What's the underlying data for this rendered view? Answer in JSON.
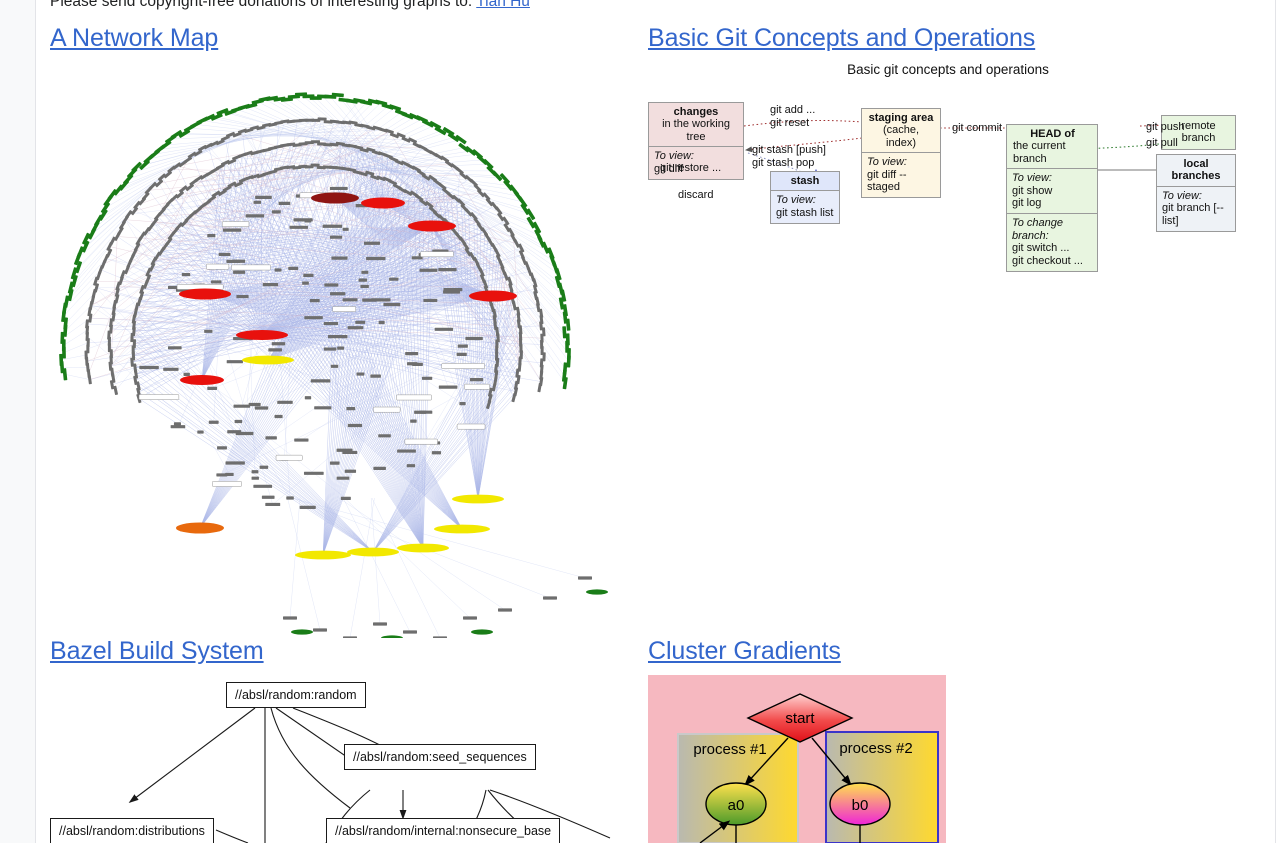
{
  "intro": {
    "text_before": "Please send copyright-free donations of interesting graphs to:",
    "link_label": "Tian Hu"
  },
  "sections": [
    {
      "id": "network-map",
      "title": "A Network Map"
    },
    {
      "id": "basic-git",
      "title": "Basic Git Concepts and Operations"
    },
    {
      "id": "bazel",
      "title": "Bazel Build System"
    },
    {
      "id": "cluster-gradients",
      "title": "Cluster Gradients"
    }
  ],
  "git": {
    "caption": "Basic git concepts and operations",
    "boxes": [
      {
        "key": "changes",
        "head_line1": "changes",
        "head_line2": "in the working tree",
        "body_label": "To view:",
        "body_cmd": "git diff",
        "color": "#f2dede"
      },
      {
        "key": "staging",
        "head_line1": "staging area",
        "head_line2": "(cache, index)",
        "body_label": "To view:",
        "body_cmd": "git diff --staged",
        "color": "#fdf6e3"
      },
      {
        "key": "stash",
        "head_line1": "stash",
        "head_line2": "",
        "body_label": "To view:",
        "body_cmd": "git stash list",
        "color": "#e8edfb"
      },
      {
        "key": "head",
        "head_line1": "HEAD of",
        "head_line2": "the current branch",
        "body_label": "To view:",
        "body_cmd": "git show\ngit log",
        "body2_label": "To change branch:",
        "body2_cmd": "git switch ...\ngit checkout ...",
        "color": "#e8f5e0"
      },
      {
        "key": "remote-branch",
        "head_line1": "remote branch",
        "head_line2": "",
        "color": "#e8f5e0"
      },
      {
        "key": "local-branches",
        "head_line1": "local branches",
        "head_line2": "",
        "body_label": "To view:",
        "body_cmd": "git branch [--list]",
        "color": "#eef2f6"
      }
    ],
    "edge_labels": [
      {
        "key": "add-reset",
        "text": "git add ...\ngit reset"
      },
      {
        "key": "stash-push-pop",
        "text": "git stash [push]\ngit stash pop"
      },
      {
        "key": "restore",
        "text": "git restore ..."
      },
      {
        "key": "discard",
        "text": "discard"
      },
      {
        "key": "commit",
        "text": "git commit"
      },
      {
        "key": "push",
        "text": "git push"
      },
      {
        "key": "pull",
        "text": "git pull"
      }
    ]
  },
  "bazel": {
    "nodes": [
      {
        "key": "random",
        "label": "//absl/random:random"
      },
      {
        "key": "seed-sequences",
        "label": "//absl/random:seed_sequences"
      },
      {
        "key": "distributions",
        "label": "//absl/random:distributions"
      },
      {
        "key": "nonsecure-base",
        "label": "//absl/random/internal:nonsecure_base"
      }
    ]
  },
  "cluster": {
    "start_label": "start",
    "clusters": [
      {
        "key": "process-1",
        "label": "process #1",
        "node_label": "a0",
        "node_fill_from": "#ffe14d",
        "node_fill_to": "#4c9a2a",
        "border": "#c0c0c0"
      },
      {
        "key": "process-2",
        "label": "process #2",
        "node_label": "b0",
        "node_fill_from": "#ffe14d",
        "node_fill_to": "#ef24d8",
        "border": "#3b34c9"
      }
    ],
    "background": "#f6b8c0",
    "start_fill_from": "#ffcccc",
    "start_fill_to": "#e8222a"
  },
  "network_map": {
    "description": "Large circular hierarchical network map with concentric rings of grey rectangular nodes, green leaf nodes on the outer ring, and red / orange / yellow highlighted hub nodes connected by pale blue and pink edges.",
    "node_colors": {
      "ring": "#6e6e6e",
      "leaf": "#1a7d18",
      "hub_red": "#e8110d",
      "hub_darkred": "#8f1513",
      "hub_orange": "#e8690d",
      "hub_yellow": "#f2e800",
      "edge_blue": "#aab6e8",
      "edge_pink": "#d8b8c8"
    }
  },
  "theme": {
    "link": "#3366cc",
    "text": "#202122",
    "rail_bg": "#f8f9fa",
    "rail_border": "#e3e4e8"
  }
}
